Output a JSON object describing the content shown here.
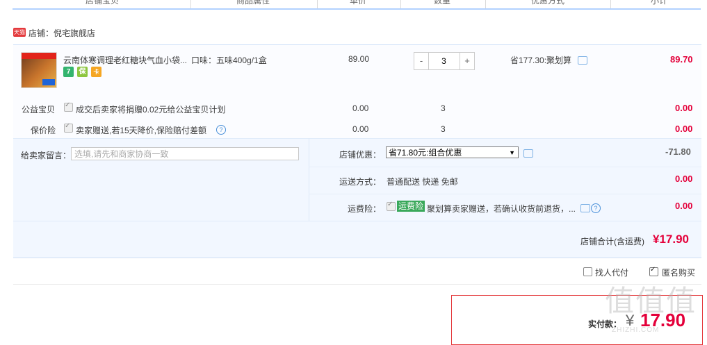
{
  "header": {
    "columns": [
      "店铺宝贝",
      "商品属性",
      "单价",
      "数量",
      "优惠方式",
      "小计"
    ]
  },
  "shop": {
    "badge": "天猫",
    "label": "店铺：",
    "name": "倪宅旗舰店"
  },
  "item": {
    "title": "云南体寒调理老红糖块气血小袋...",
    "attr": "口味：五味400g/1盒",
    "price": "89.00",
    "qty": "3",
    "discount": "省177.30:聚划算",
    "subtotal": "89.70",
    "minus": "-",
    "plus": "+",
    "service_icons": [
      "7",
      "保",
      "卡"
    ]
  },
  "charity": {
    "label": "公益宝贝",
    "text": "成交后卖家将捐赠0.02元给公益宝贝计划",
    "price": "0.00",
    "qty": "3",
    "subtotal": "0.00"
  },
  "price_protect": {
    "label": "保价险",
    "text": "卖家赠送,若15天降价,保险赔付差额",
    "price": "0.00",
    "qty": "3",
    "subtotal": "0.00",
    "help": "?"
  },
  "message": {
    "label": "给卖家留言：",
    "placeholder": "选填,请先和商家协商一致"
  },
  "shop_discount": {
    "label": "店铺优惠：",
    "selected": "省71.80元:组合优惠",
    "amount": "-71.80"
  },
  "shipping": {
    "label": "运送方式：",
    "value": "普通配送 快递 免邮",
    "amount": "0.00"
  },
  "freight_insurance": {
    "label": "运费险：",
    "tag": "运费险",
    "text": "聚划算卖家赠送，若确认收货前退货，...",
    "amount": "0.00",
    "help": "?"
  },
  "total": {
    "label": "店铺合计(含运费)",
    "value": "¥17.90"
  },
  "options": {
    "proxy_label": "找人代付",
    "anonymous_label": "匿名购买"
  },
  "payment": {
    "label": "实付款：",
    "currency": "¥",
    "value": "17.90"
  },
  "watermark": {
    "text": "值值值",
    "url": "ZHIZHI.COM"
  },
  "colors": {
    "accent_red": "#e4003a",
    "border_blue": "#b2d1ff",
    "insurance_green": "#39a85a"
  }
}
